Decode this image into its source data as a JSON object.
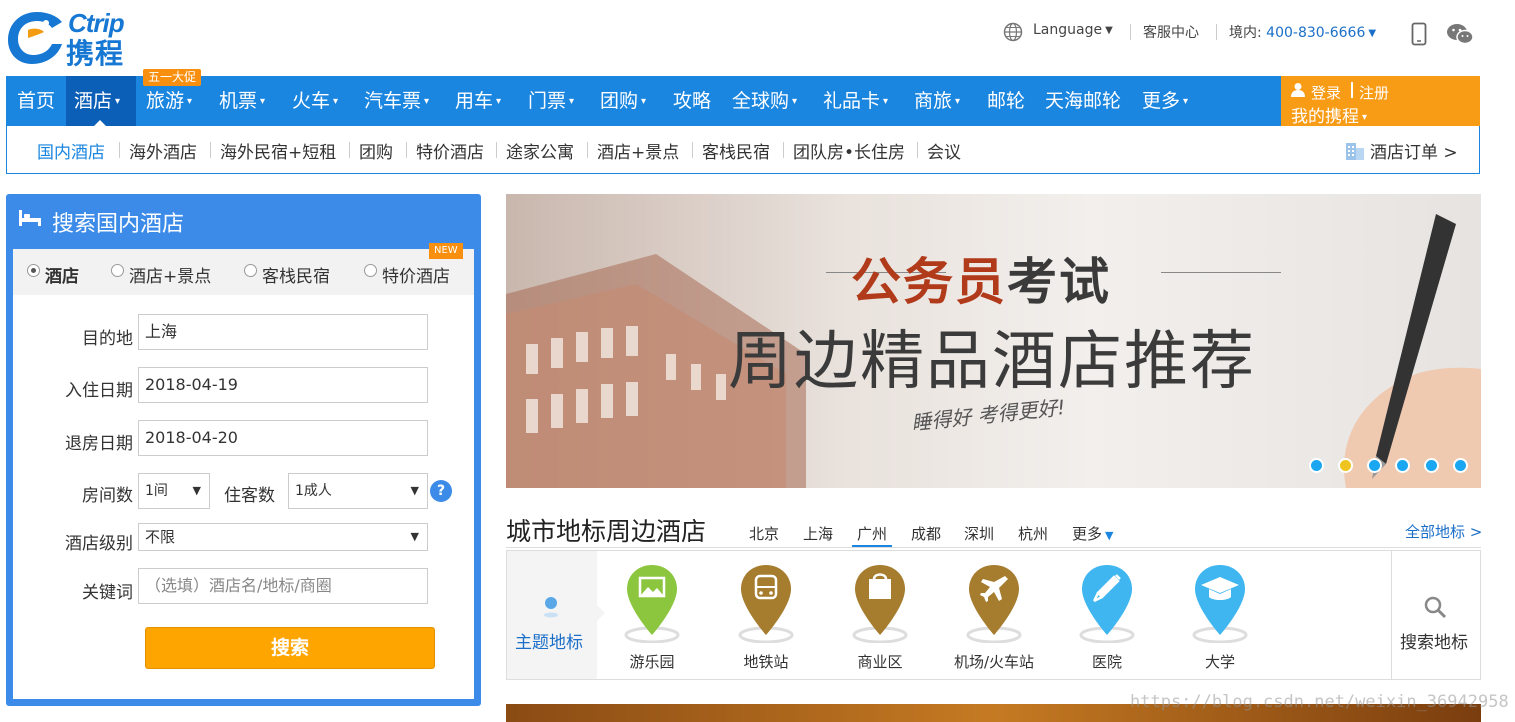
{
  "header": {
    "logo_en": "Ctrip",
    "logo_cn": "携程",
    "language_label": "Language",
    "service_center": "客服中心",
    "hotline_label": "境内:",
    "hotline_number": "400-830-6666"
  },
  "nav": {
    "items": [
      "首页",
      "酒店",
      "旅游",
      "机票",
      "火车",
      "汽车票",
      "用车",
      "门票",
      "团购",
      "攻略",
      "全球购",
      "礼品卡",
      "商旅",
      "邮轮",
      "天海邮轮",
      "更多"
    ],
    "promo_badge": "五一大促",
    "login": "登录",
    "register": "注册",
    "my_ctrip": "我的携程"
  },
  "subnav": {
    "items": [
      "国内酒店",
      "海外酒店",
      "海外民宿+短租",
      "团购",
      "特价酒店",
      "途家公寓",
      "酒店+景点",
      "客栈民宿",
      "团队房•长住房",
      "会议"
    ],
    "orders": "酒店订单 >"
  },
  "search": {
    "title": "搜索国内酒店",
    "new_badge": "NEW",
    "tabs": [
      "酒店",
      "酒店+景点",
      "客栈民宿",
      "特价酒店"
    ],
    "destination_label": "目的地",
    "destination_value": "上海",
    "checkin_label": "入住日期",
    "checkin_value": "2018-04-19",
    "checkout_label": "退房日期",
    "checkout_value": "2018-04-20",
    "rooms_label": "房间数",
    "rooms_value": "1间",
    "guests_label": "住客数",
    "guests_value": "1成人",
    "help": "?",
    "level_label": "酒店级别",
    "level_value": "不限",
    "keyword_label": "关键词",
    "keyword_placeholder": "（选填）酒店名/地标/商圈",
    "button": "搜索"
  },
  "banner": {
    "title_part1": "公务员",
    "title_part2": "考试",
    "subtitle": "周边精品酒店推荐",
    "handwriting": "睡得好 考得更好!",
    "dots": 6,
    "active_dot": 2
  },
  "landmarks": {
    "title": "城市地标周边酒店",
    "cities": [
      "北京",
      "上海",
      "广州",
      "成都",
      "深圳",
      "杭州",
      "更多"
    ],
    "active_city": "广州",
    "all_link": "全部地标 >",
    "theme_label": "主题地标",
    "categories": [
      "游乐园",
      "地铁站",
      "商业区",
      "机场/火车站",
      "医院",
      "大学"
    ],
    "search_label": "搜索地标"
  },
  "watermark": "https://blog.csdn.net/weixin_36942958",
  "colors": {
    "brand_blue": "#1b86e0",
    "nav_active": "#0b5fb6",
    "orange": "#f89b15",
    "banner_title_red": "#b03a1a",
    "banner_title_dark": "#3a3a3a",
    "pin_green": "#8cc63f",
    "pin_gold": "#a67c2e",
    "pin_blue": "#3fb6f0"
  }
}
